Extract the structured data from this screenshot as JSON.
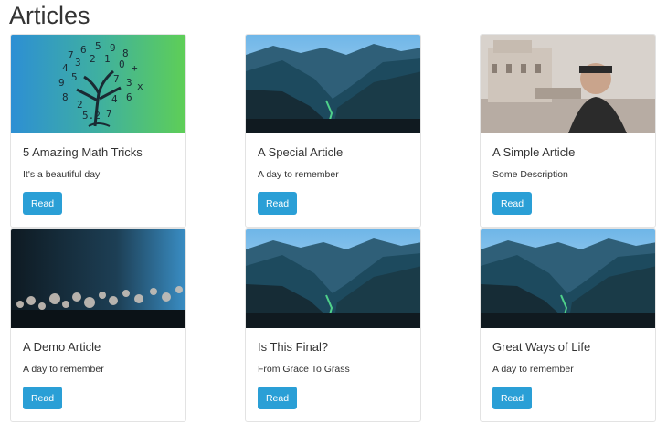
{
  "page": {
    "title": "Articles"
  },
  "theme": {
    "accent": "#2a9fd6"
  },
  "articles": [
    {
      "title": "5 Amazing Math Tricks",
      "description": "It's a beautiful day",
      "button": "Read",
      "image": "math-tree-image"
    },
    {
      "title": "A Special Article",
      "description": "A day to remember",
      "button": "Read",
      "image": "mountain-valley-image"
    },
    {
      "title": "A Simple Article",
      "description": "Some Description",
      "button": "Read",
      "image": "fortress-portrait-image"
    },
    {
      "title": "A Demo Article",
      "description": "A day to remember",
      "button": "Read",
      "image": "dark-flowers-image"
    },
    {
      "title": "Is This Final?",
      "description": "From Grace To Grass",
      "button": "Read",
      "image": "mountain-valley-image"
    },
    {
      "title": "Great Ways of Life",
      "description": "A day to remember",
      "button": "Read",
      "image": "mountain-valley-image"
    }
  ]
}
